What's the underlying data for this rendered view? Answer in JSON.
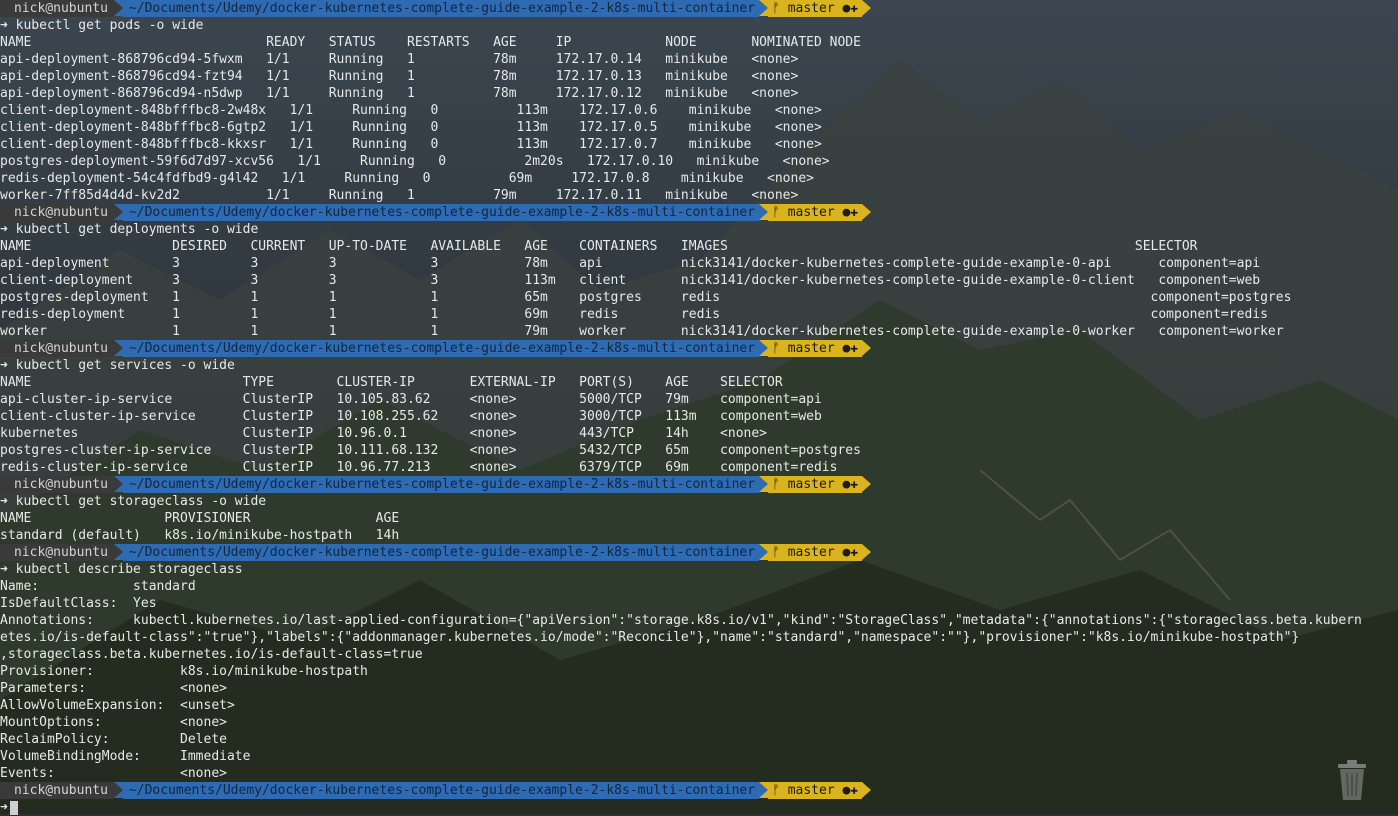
{
  "prompt": {
    "user": "nick@nubuntu",
    "path": "~/Documents/Udemy/docker-kubernetes-complete-guide-example-2-k8s-multi-container",
    "branch": "ᚠ master ●✚",
    "arrow": "➜"
  },
  "blocks": [
    {
      "command": " kubectl get pods -o wide",
      "lines": [
        "NAME                              READY   STATUS    RESTARTS   AGE     IP            NODE       NOMINATED NODE",
        "api-deployment-868796cd94-5fwxm   1/1     Running   1          78m     172.17.0.14   minikube   <none>",
        "api-deployment-868796cd94-fzt94   1/1     Running   1          78m     172.17.0.13   minikube   <none>",
        "api-deployment-868796cd94-n5dwp   1/1     Running   1          78m     172.17.0.12   minikube   <none>",
        "client-deployment-848bfffbc8-2w48x   1/1     Running   0          113m    172.17.0.6    minikube   <none>",
        "client-deployment-848bfffbc8-6gtp2   1/1     Running   0          113m    172.17.0.5    minikube   <none>",
        "client-deployment-848bfffbc8-kkxsr   1/1     Running   0          113m    172.17.0.7    minikube   <none>",
        "postgres-deployment-59f6d7d97-xcv56   1/1     Running   0          2m20s   172.17.0.10   minikube   <none>",
        "redis-deployment-54c4fdfbd9-g4l42   1/1     Running   0          69m     172.17.0.8    minikube   <none>",
        "worker-7ff85d4d4d-kv2d2           1/1     Running   1          79m     172.17.0.11   minikube   <none>"
      ]
    },
    {
      "command": " kubectl get deployments -o wide",
      "lines": [
        "NAME                  DESIRED   CURRENT   UP-TO-DATE   AVAILABLE   AGE    CONTAINERS   IMAGES                                                    SELECTOR",
        "api-deployment        3         3         3            3           78m    api          nick3141/docker-kubernetes-complete-guide-example-0-api      component=api",
        "client-deployment     3         3         3            3           113m   client       nick3141/docker-kubernetes-complete-guide-example-0-client   component=web",
        "postgres-deployment   1         1         1            1           65m    postgres     redis                                                       component=postgres",
        "redis-deployment      1         1         1            1           69m    redis        redis                                                       component=redis",
        "worker                1         1         1            1           79m    worker       nick3141/docker-kubernetes-complete-guide-example-0-worker   component=worker"
      ]
    },
    {
      "command": " kubectl get services -o wide",
      "lines": [
        "NAME                           TYPE        CLUSTER-IP       EXTERNAL-IP   PORT(S)    AGE    SELECTOR",
        "api-cluster-ip-service         ClusterIP   10.105.83.62     <none>        5000/TCP   79m    component=api",
        "client-cluster-ip-service      ClusterIP   10.108.255.62    <none>        3000/TCP   113m   component=web",
        "kubernetes                     ClusterIP   10.96.0.1        <none>        443/TCP    14h    <none>",
        "postgres-cluster-ip-service    ClusterIP   10.111.68.132    <none>        5432/TCP   65m    component=postgres",
        "redis-cluster-ip-service       ClusterIP   10.96.77.213     <none>        6379/TCP   69m    component=redis"
      ]
    },
    {
      "command": " kubectl get storageclass -o wide",
      "lines": [
        "NAME                 PROVISIONER                AGE",
        "standard (default)   k8s.io/minikube-hostpath   14h"
      ]
    },
    {
      "command": " kubectl describe storageclass",
      "lines": [
        "Name:            standard",
        "IsDefaultClass:  Yes",
        "Annotations:     kubectl.kubernetes.io/last-applied-configuration={\"apiVersion\":\"storage.k8s.io/v1\",\"kind\":\"StorageClass\",\"metadata\":{\"annotations\":{\"storageclass.beta.kubern",
        "etes.io/is-default-class\":\"true\"},\"labels\":{\"addonmanager.kubernetes.io/mode\":\"Reconcile\"},\"name\":\"standard\",\"namespace\":\"\"},\"provisioner\":\"k8s.io/minikube-hostpath\"}",
        ",storageclass.beta.kubernetes.io/is-default-class=true",
        "Provisioner:           k8s.io/minikube-hostpath",
        "Parameters:            <none>",
        "AllowVolumeExpansion:  <unset>",
        "MountOptions:          <none>",
        "ReclaimPolicy:         Delete",
        "VolumeBindingMode:     Immediate",
        "Events:                <none>"
      ]
    }
  ]
}
